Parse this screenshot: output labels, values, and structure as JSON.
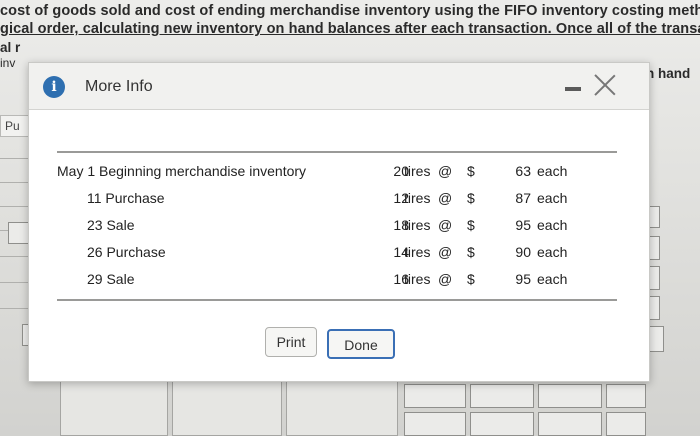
{
  "background": {
    "line1": "cost of goods sold and cost of ending merchandise inventory using the FIFO inventory costing metho",
    "line2": "gical order, calculating new inventory on hand balances after each transaction. Once all of the transac",
    "fragment_al": "al r",
    "fragment_inv": "inv",
    "fragment_hand": "n hand",
    "tab_label": "Pu",
    "fragment_right": "t"
  },
  "modal": {
    "title": "More Info",
    "info_icon_glyph": "i",
    "rows": [
      {
        "label": "May 1 Beginning merchandise inventory",
        "qty": "20",
        "unit": "tires",
        "at": "@",
        "dollar": "$",
        "price": "63",
        "each": "each"
      },
      {
        "label": "11 Purchase",
        "qty": "12",
        "unit": "tires",
        "at": "@",
        "dollar": "$",
        "price": "87",
        "each": "each"
      },
      {
        "label": "23 Sale",
        "qty": "18",
        "unit": "tires",
        "at": "@",
        "dollar": "$",
        "price": "95",
        "each": "each"
      },
      {
        "label": "26 Purchase",
        "qty": "14",
        "unit": "tires",
        "at": "@",
        "dollar": "$",
        "price": "90",
        "each": "each"
      },
      {
        "label": "29 Sale",
        "qty": "16",
        "unit": "tires",
        "at": "@",
        "dollar": "$",
        "price": "95",
        "each": "each"
      }
    ],
    "print_label": "Print",
    "done_label": "Done"
  }
}
